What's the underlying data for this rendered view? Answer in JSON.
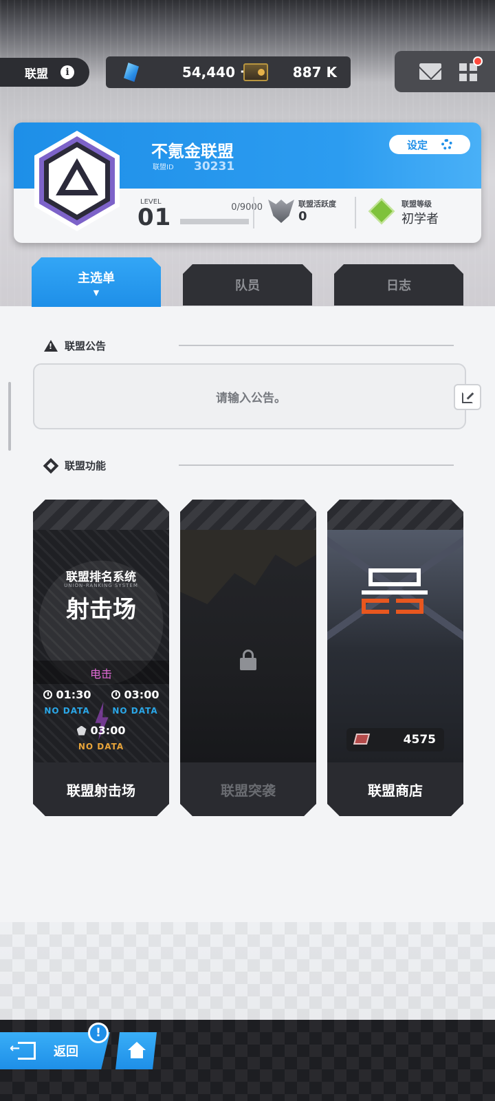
{
  "header": {
    "union_label": "联盟",
    "info_icon": "info-icon",
    "gems": "54,440",
    "gems_plus": "+",
    "tickets": "887 K"
  },
  "union": {
    "name": "不氪金联盟",
    "id_label": "联盟ID",
    "id_value": "30231",
    "settings_label": "设定",
    "level_label": "LEVEL",
    "level_value": "01",
    "exp_text": "0/9000",
    "exp_progress": 0,
    "activity_label": "联盟活跃度",
    "activity_value": "0",
    "rank_label": "联盟等级",
    "rank_value": "初学者"
  },
  "tabs": {
    "main": "主选单",
    "members": "队员",
    "log": "日志",
    "caret": "▼"
  },
  "notice": {
    "title": "联盟公告",
    "placeholder": "请输入公告。"
  },
  "functions": {
    "title": "联盟功能",
    "shooting": {
      "art_title_small": "联盟排名系统",
      "art_subtitle": "UNION-RANKING SYSTEM",
      "art_title_big": "射击场",
      "mode": "电击",
      "timer1": "01:30",
      "timer2": "03:00",
      "timer3": "03:00",
      "nodata": "NO DATA",
      "label": "联盟射击场"
    },
    "raid": {
      "label": "联盟突袭",
      "locked": true
    },
    "shop": {
      "coin_value": "4575",
      "label": "联盟商店"
    }
  },
  "nav": {
    "back_label": "返回",
    "alert": "!"
  },
  "colors": {
    "accent_blue": "#1e8fe8",
    "mode_purple": "#e06ad6",
    "nodata_blue": "#2aa7e8",
    "nodata_orange": "#e9a53a",
    "notification_red": "#ff4a3d"
  }
}
